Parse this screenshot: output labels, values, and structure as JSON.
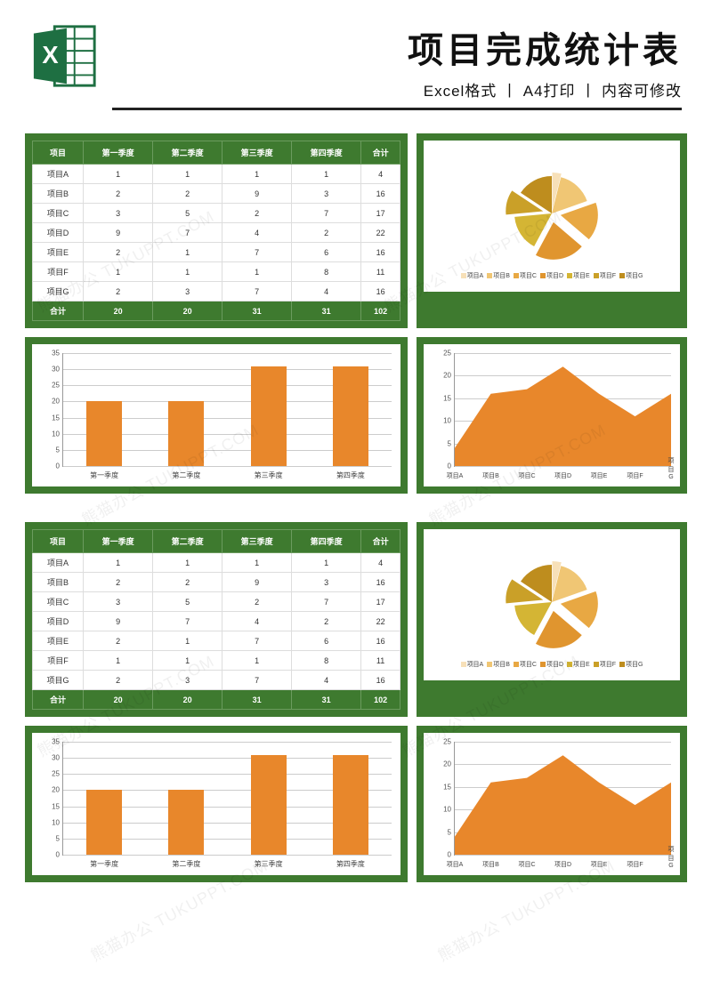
{
  "header": {
    "title": "项目完成统计表",
    "sub": "Excel格式 丨 A4打印 丨 内容可修改",
    "icon_name": "excel-icon"
  },
  "watermark": "熊猫办公 TUKUPPT.COM",
  "table": {
    "headers": [
      "项目",
      "第一季度",
      "第二季度",
      "第三季度",
      "第四季度",
      "合计"
    ],
    "rows": [
      [
        "项目A",
        "1",
        "1",
        "1",
        "1",
        "4"
      ],
      [
        "项目B",
        "2",
        "2",
        "9",
        "3",
        "16"
      ],
      [
        "项目C",
        "3",
        "5",
        "2",
        "7",
        "17"
      ],
      [
        "项目D",
        "9",
        "7",
        "4",
        "2",
        "22"
      ],
      [
        "项目E",
        "2",
        "1",
        "7",
        "6",
        "16"
      ],
      [
        "项目F",
        "1",
        "1",
        "1",
        "8",
        "11"
      ],
      [
        "项目G",
        "2",
        "3",
        "7",
        "4",
        "16"
      ]
    ],
    "total": [
      "合计",
      "20",
      "20",
      "31",
      "31",
      "102"
    ]
  },
  "pie_legend": [
    "项目A",
    "项目B",
    "项目C",
    "项目D",
    "项目E",
    "项目F",
    "项目G"
  ],
  "pie_colors": [
    "#f7e0b8",
    "#f0c674",
    "#e8a843",
    "#e0952f",
    "#d4b534",
    "#caa028",
    "#be8d1e"
  ],
  "chart_data": [
    {
      "type": "bar",
      "title": "",
      "categories": [
        "第一季度",
        "第二季度",
        "第三季度",
        "第四季度"
      ],
      "values": [
        20,
        20,
        31,
        31
      ],
      "ylim": [
        0,
        35
      ],
      "yticks": [
        0,
        5,
        10,
        15,
        20,
        25,
        30,
        35
      ],
      "xlabel": "",
      "ylabel": ""
    },
    {
      "type": "pie",
      "title": "",
      "categories": [
        "项目A",
        "项目B",
        "项目C",
        "项目D",
        "项目E",
        "项目F",
        "项目G"
      ],
      "values": [
        4,
        16,
        17,
        22,
        16,
        11,
        16
      ],
      "colors": [
        "#f7e0b8",
        "#f0c674",
        "#e8a843",
        "#e0952f",
        "#d4b534",
        "#caa028",
        "#be8d1e"
      ]
    },
    {
      "type": "area",
      "title": "",
      "categories": [
        "项目A",
        "项目B",
        "项目C",
        "项目D",
        "项目E",
        "项目F",
        "项目G"
      ],
      "values": [
        4,
        16,
        17,
        22,
        16,
        11,
        16
      ],
      "ylim": [
        0,
        25
      ],
      "yticks": [
        0,
        5,
        10,
        15,
        20,
        25
      ],
      "xlabel": "",
      "ylabel": ""
    }
  ]
}
